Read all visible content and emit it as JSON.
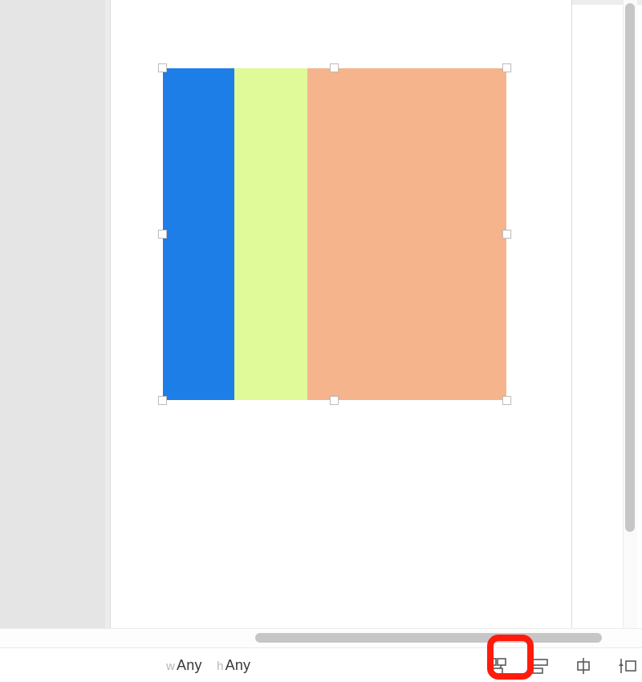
{
  "canvas": {
    "stackview": {
      "columns": [
        {
          "name": "blue-view",
          "color": "#1e7ee8"
        },
        {
          "name": "green-view",
          "color": "#e0f999"
        },
        {
          "name": "orange-view",
          "color": "#f6b48d"
        }
      ]
    }
  },
  "bottom": {
    "size_class": {
      "w_prefix": "w",
      "w_value": "Any",
      "h_prefix": "h",
      "h_value": "Any"
    },
    "mode_buttons": [
      {
        "name": "constraints-icon"
      },
      {
        "name": "align-icon"
      },
      {
        "name": "pin-icon"
      },
      {
        "name": "resolve-icon"
      }
    ]
  }
}
